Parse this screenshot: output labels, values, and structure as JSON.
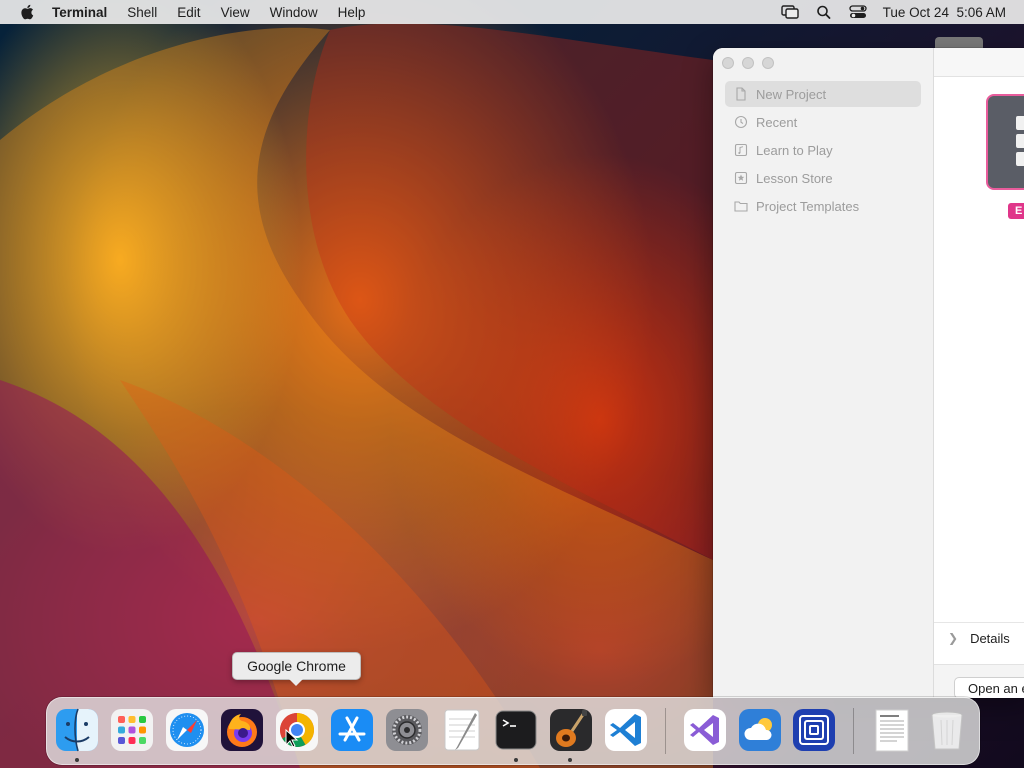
{
  "menubar": {
    "app_name": "Terminal",
    "items": [
      "Shell",
      "Edit",
      "View",
      "Window",
      "Help"
    ],
    "datetime": "Tue Oct 24  5:06 AM",
    "status_icons": [
      "screen-mirroring-icon",
      "spotlight-search-icon",
      "control-center-icon"
    ]
  },
  "dialog": {
    "sidebar": {
      "items": [
        {
          "label": "New Project",
          "icon": "document-icon",
          "selected": true
        },
        {
          "label": "Recent",
          "icon": "clock-icon",
          "selected": false
        },
        {
          "label": "Learn to Play",
          "icon": "music-note-icon",
          "selected": false
        },
        {
          "label": "Lesson Store",
          "icon": "star-icon",
          "selected": false
        },
        {
          "label": "Project Templates",
          "icon": "folder-icon",
          "selected": false
        }
      ]
    },
    "template_badge": "E",
    "details_label": "Details",
    "open_button_label": "Open an e"
  },
  "tooltip": {
    "text": "Google Chrome"
  },
  "dock": {
    "apps": [
      {
        "name": "Finder",
        "running": true
      },
      {
        "name": "Launchpad",
        "running": false
      },
      {
        "name": "Safari",
        "running": false
      },
      {
        "name": "Firefox",
        "running": false
      },
      {
        "name": "Google Chrome",
        "running": false
      },
      {
        "name": "App Store",
        "running": false
      },
      {
        "name": "System Settings",
        "running": false
      },
      {
        "name": "TextEdit",
        "running": false
      },
      {
        "name": "Terminal",
        "running": true
      },
      {
        "name": "GarageBand",
        "running": true
      },
      {
        "name": "Visual Studio Code",
        "running": false
      },
      {
        "name": "Visual Studio",
        "running": false
      },
      {
        "name": "iCloud Weather",
        "running": false
      },
      {
        "name": "Code Layers",
        "running": false
      },
      {
        "name": "Document",
        "running": false
      },
      {
        "name": "Trash",
        "running": false
      }
    ]
  }
}
